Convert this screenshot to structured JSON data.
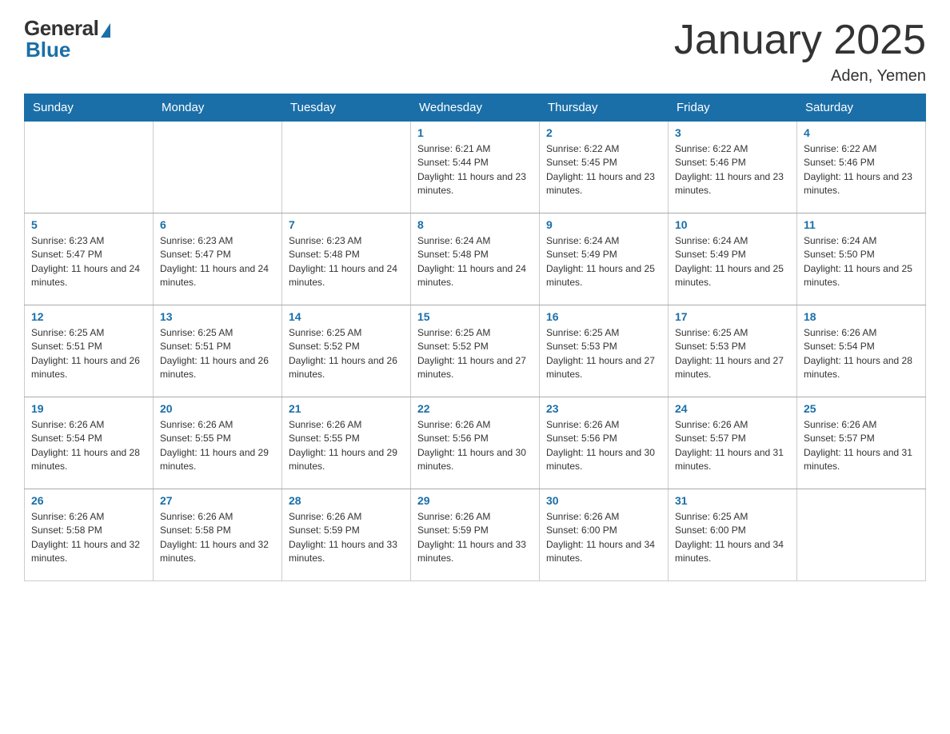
{
  "header": {
    "logo_general": "General",
    "logo_blue": "Blue",
    "title": "January 2025",
    "subtitle": "Aden, Yemen"
  },
  "days_of_week": [
    "Sunday",
    "Monday",
    "Tuesday",
    "Wednesday",
    "Thursday",
    "Friday",
    "Saturday"
  ],
  "weeks": [
    [
      {
        "day": "",
        "info": ""
      },
      {
        "day": "",
        "info": ""
      },
      {
        "day": "",
        "info": ""
      },
      {
        "day": "1",
        "info": "Sunrise: 6:21 AM\nSunset: 5:44 PM\nDaylight: 11 hours and 23 minutes."
      },
      {
        "day": "2",
        "info": "Sunrise: 6:22 AM\nSunset: 5:45 PM\nDaylight: 11 hours and 23 minutes."
      },
      {
        "day": "3",
        "info": "Sunrise: 6:22 AM\nSunset: 5:46 PM\nDaylight: 11 hours and 23 minutes."
      },
      {
        "day": "4",
        "info": "Sunrise: 6:22 AM\nSunset: 5:46 PM\nDaylight: 11 hours and 23 minutes."
      }
    ],
    [
      {
        "day": "5",
        "info": "Sunrise: 6:23 AM\nSunset: 5:47 PM\nDaylight: 11 hours and 24 minutes."
      },
      {
        "day": "6",
        "info": "Sunrise: 6:23 AM\nSunset: 5:47 PM\nDaylight: 11 hours and 24 minutes."
      },
      {
        "day": "7",
        "info": "Sunrise: 6:23 AM\nSunset: 5:48 PM\nDaylight: 11 hours and 24 minutes."
      },
      {
        "day": "8",
        "info": "Sunrise: 6:24 AM\nSunset: 5:48 PM\nDaylight: 11 hours and 24 minutes."
      },
      {
        "day": "9",
        "info": "Sunrise: 6:24 AM\nSunset: 5:49 PM\nDaylight: 11 hours and 25 minutes."
      },
      {
        "day": "10",
        "info": "Sunrise: 6:24 AM\nSunset: 5:49 PM\nDaylight: 11 hours and 25 minutes."
      },
      {
        "day": "11",
        "info": "Sunrise: 6:24 AM\nSunset: 5:50 PM\nDaylight: 11 hours and 25 minutes."
      }
    ],
    [
      {
        "day": "12",
        "info": "Sunrise: 6:25 AM\nSunset: 5:51 PM\nDaylight: 11 hours and 26 minutes."
      },
      {
        "day": "13",
        "info": "Sunrise: 6:25 AM\nSunset: 5:51 PM\nDaylight: 11 hours and 26 minutes."
      },
      {
        "day": "14",
        "info": "Sunrise: 6:25 AM\nSunset: 5:52 PM\nDaylight: 11 hours and 26 minutes."
      },
      {
        "day": "15",
        "info": "Sunrise: 6:25 AM\nSunset: 5:52 PM\nDaylight: 11 hours and 27 minutes."
      },
      {
        "day": "16",
        "info": "Sunrise: 6:25 AM\nSunset: 5:53 PM\nDaylight: 11 hours and 27 minutes."
      },
      {
        "day": "17",
        "info": "Sunrise: 6:25 AM\nSunset: 5:53 PM\nDaylight: 11 hours and 27 minutes."
      },
      {
        "day": "18",
        "info": "Sunrise: 6:26 AM\nSunset: 5:54 PM\nDaylight: 11 hours and 28 minutes."
      }
    ],
    [
      {
        "day": "19",
        "info": "Sunrise: 6:26 AM\nSunset: 5:54 PM\nDaylight: 11 hours and 28 minutes."
      },
      {
        "day": "20",
        "info": "Sunrise: 6:26 AM\nSunset: 5:55 PM\nDaylight: 11 hours and 29 minutes."
      },
      {
        "day": "21",
        "info": "Sunrise: 6:26 AM\nSunset: 5:55 PM\nDaylight: 11 hours and 29 minutes."
      },
      {
        "day": "22",
        "info": "Sunrise: 6:26 AM\nSunset: 5:56 PM\nDaylight: 11 hours and 30 minutes."
      },
      {
        "day": "23",
        "info": "Sunrise: 6:26 AM\nSunset: 5:56 PM\nDaylight: 11 hours and 30 minutes."
      },
      {
        "day": "24",
        "info": "Sunrise: 6:26 AM\nSunset: 5:57 PM\nDaylight: 11 hours and 31 minutes."
      },
      {
        "day": "25",
        "info": "Sunrise: 6:26 AM\nSunset: 5:57 PM\nDaylight: 11 hours and 31 minutes."
      }
    ],
    [
      {
        "day": "26",
        "info": "Sunrise: 6:26 AM\nSunset: 5:58 PM\nDaylight: 11 hours and 32 minutes."
      },
      {
        "day": "27",
        "info": "Sunrise: 6:26 AM\nSunset: 5:58 PM\nDaylight: 11 hours and 32 minutes."
      },
      {
        "day": "28",
        "info": "Sunrise: 6:26 AM\nSunset: 5:59 PM\nDaylight: 11 hours and 33 minutes."
      },
      {
        "day": "29",
        "info": "Sunrise: 6:26 AM\nSunset: 5:59 PM\nDaylight: 11 hours and 33 minutes."
      },
      {
        "day": "30",
        "info": "Sunrise: 6:26 AM\nSunset: 6:00 PM\nDaylight: 11 hours and 34 minutes."
      },
      {
        "day": "31",
        "info": "Sunrise: 6:25 AM\nSunset: 6:00 PM\nDaylight: 11 hours and 34 minutes."
      },
      {
        "day": "",
        "info": ""
      }
    ]
  ]
}
